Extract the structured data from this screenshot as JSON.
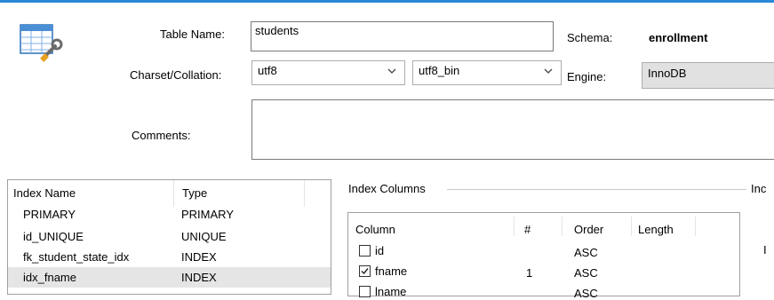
{
  "header": {
    "table_name_label": "Table Name:",
    "table_name_value": "students",
    "schema_label": "Schema:",
    "schema_value": "enrollment",
    "charset_label": "Charset/Collation:",
    "charset_value": "utf8",
    "collation_value": "utf8_bin",
    "engine_label": "Engine:",
    "engine_value": "InnoDB",
    "comments_label": "Comments:",
    "comments_value": ""
  },
  "indexes": {
    "columns": [
      "Index Name",
      "Type"
    ],
    "rows": [
      {
        "name": "PRIMARY",
        "type": "PRIMARY"
      },
      {
        "name": "id_UNIQUE",
        "type": "UNIQUE"
      },
      {
        "name": "fk_student_state_idx",
        "type": "INDEX"
      },
      {
        "name": "idx_fname",
        "type": "INDEX"
      }
    ],
    "selected_index": 3
  },
  "index_columns": {
    "group_label": "Index Columns",
    "right_group_label": "Inc",
    "right_group_partial": "I",
    "columns": [
      "Column",
      "#",
      "Order",
      "Length"
    ],
    "rows": [
      {
        "column": "id",
        "checked": false,
        "num": "",
        "order": "ASC",
        "length": ""
      },
      {
        "column": "fname",
        "checked": true,
        "num": "1",
        "order": "ASC",
        "length": ""
      },
      {
        "column": "lname",
        "checked": false,
        "num": "",
        "order": "ASC",
        "length": ""
      }
    ]
  },
  "icons": {
    "table": "table-edit-icon",
    "dropdown": "chevron-down-icon",
    "check": "checkmark-icon"
  },
  "colors": {
    "accent_line": "#2b87d8",
    "selection": "#e5e5e5",
    "border": "#7a7a7a"
  }
}
